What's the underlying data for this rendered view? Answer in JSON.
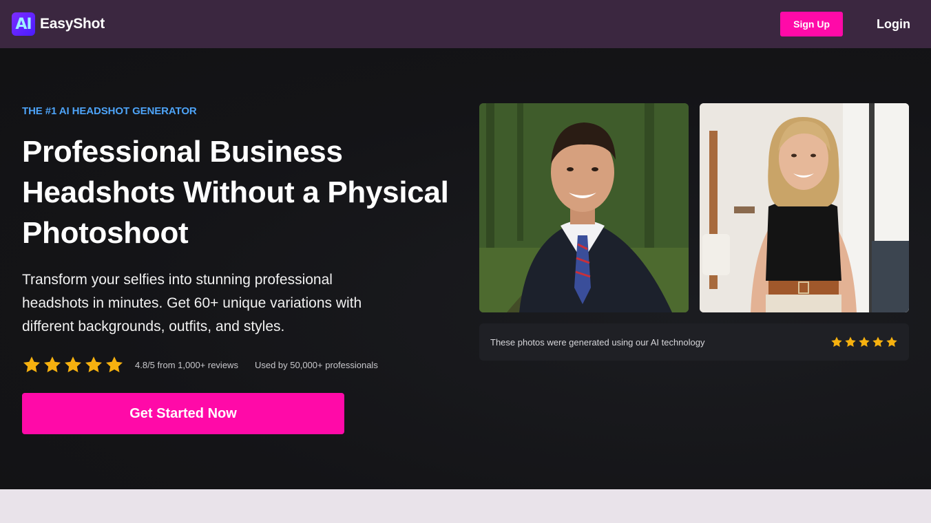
{
  "nav": {
    "logo_text": "AI",
    "brand": "EasyShot",
    "signup_label": "Sign Up",
    "login_label": "Login"
  },
  "hero": {
    "eyebrow": "THE #1 AI HEADSHOT GENERATOR",
    "headline": "Professional Business Headshots Without a Physical Photoshoot",
    "subtext": "Transform your selfies into stunning professional headshots in minutes. Get 60+ unique variations with different backgrounds, outfits, and styles.",
    "rating_stars": 5,
    "rating_text": "4.8/5 from 1,000+ reviews",
    "users_text": "Used by 50,000+ professionals",
    "cta_label": "Get Started Now"
  },
  "gallery": {
    "caption": "These photos were generated using our AI technology",
    "caption_stars": 5
  },
  "colors": {
    "nav_bg": "#3b2740",
    "accent_pink": "#ff0aa8",
    "eyebrow_blue": "#4da3f7",
    "star_gold": "#f6b10f",
    "hero_bg": "#141417"
  }
}
